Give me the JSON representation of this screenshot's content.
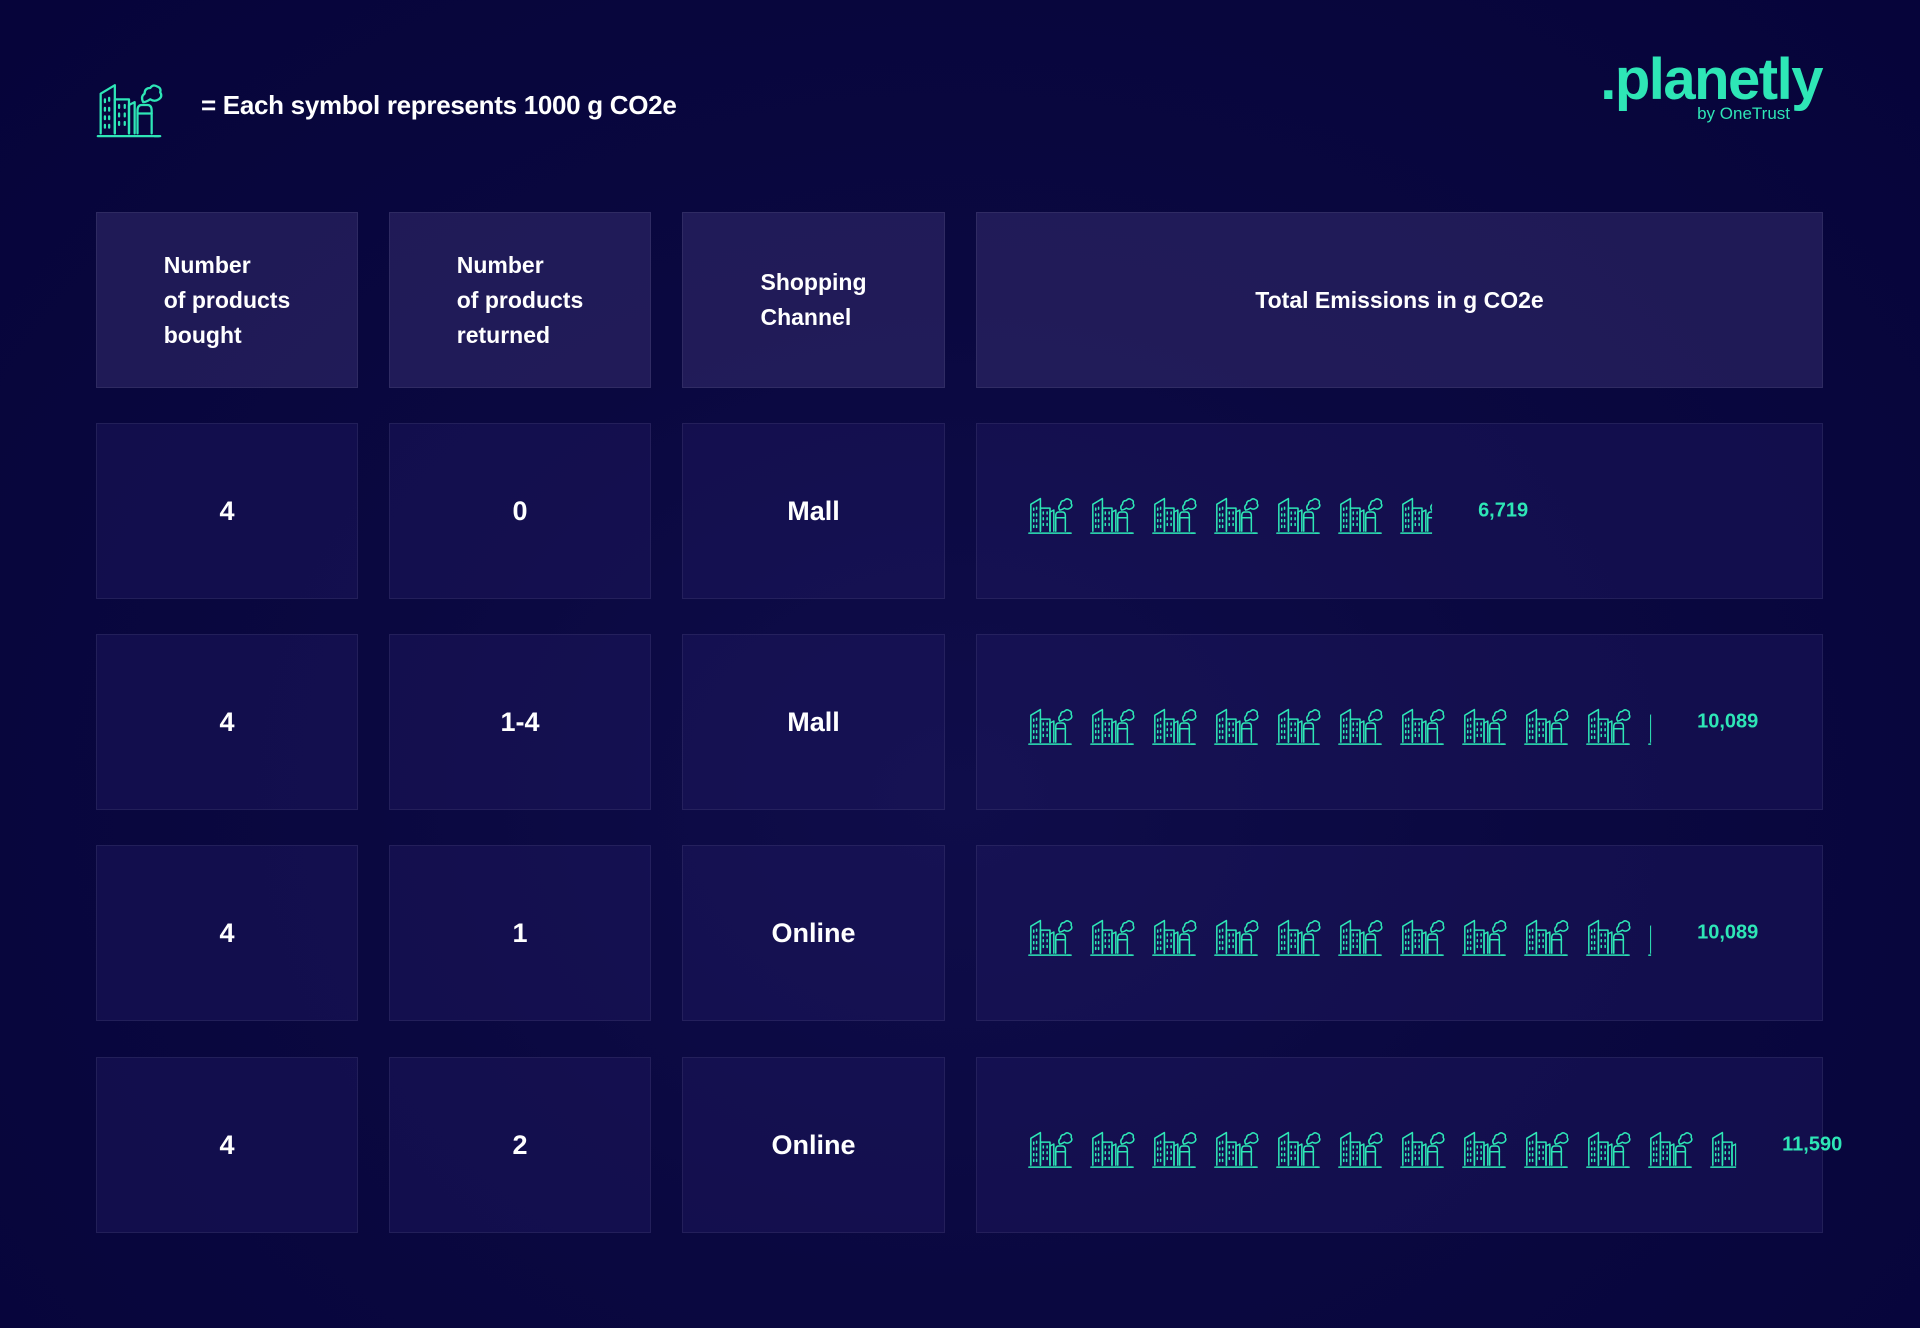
{
  "legend": {
    "text": "= Each symbol represents  1000 g CO2e",
    "icon": "factory-building-icon"
  },
  "logo": {
    "name": ".planetly",
    "sub": "by OneTrust"
  },
  "colors": {
    "accent": "#2ee6b6",
    "background": "#0a0840"
  },
  "headers": [
    "Number\nof products\nbought",
    "Number\nof products\nreturned",
    "Shopping\nChannel",
    "Total Emissions in g CO2e"
  ],
  "chart_data": {
    "type": "table",
    "unit_per_symbol": 1000,
    "columns": [
      "Number of products bought",
      "Number of products returned",
      "Shopping Channel",
      "Total Emissions in g CO2e"
    ],
    "rows": [
      {
        "bought": "4",
        "returned": "0",
        "channel": "Mall",
        "emissions": 6719,
        "emissions_label": "6,719"
      },
      {
        "bought": "4",
        "returned": "1-4",
        "channel": "Mall",
        "emissions": 10089,
        "emissions_label": "10,089"
      },
      {
        "bought": "4",
        "returned": "1",
        "channel": "Online",
        "emissions": 10089,
        "emissions_label": "10,089"
      },
      {
        "bought": "4",
        "returned": "2",
        "channel": "Online",
        "emissions": 11590,
        "emissions_label": "11,590"
      }
    ]
  }
}
